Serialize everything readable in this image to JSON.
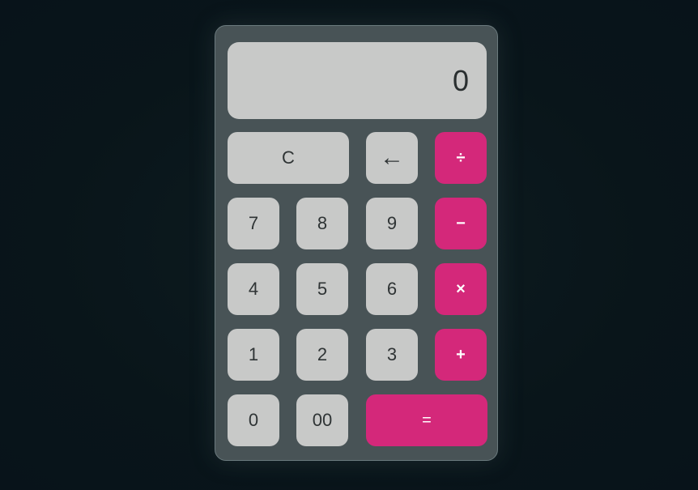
{
  "display": {
    "value": "0"
  },
  "keys": {
    "clear": "C",
    "backspace": "←",
    "divide": "÷",
    "seven": "7",
    "eight": "8",
    "nine": "9",
    "minus": "−",
    "four": "4",
    "five": "5",
    "six": "6",
    "multiply": "×",
    "one": "1",
    "two": "2",
    "three": "3",
    "plus": "+",
    "zero": "0",
    "double_zero": "00",
    "equals": "="
  },
  "colors": {
    "background": "#0a1519",
    "body": "#485356",
    "key": "#c8c9c8",
    "operator": "#d4287a"
  }
}
